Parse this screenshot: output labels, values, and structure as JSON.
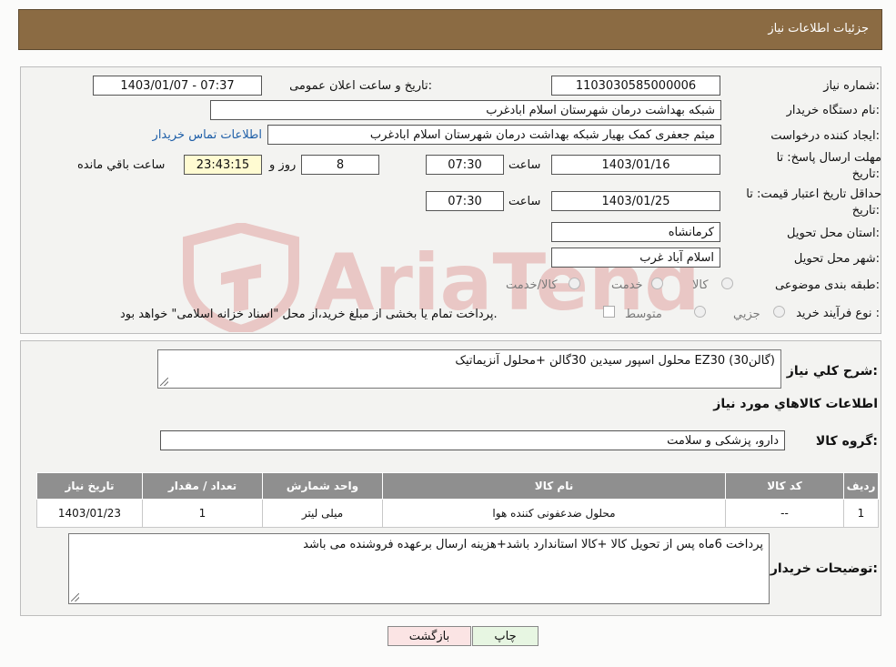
{
  "header": {
    "title": "جزئیات اطلاعات نیاز"
  },
  "form": {
    "need_number_label": "شماره نیاز:",
    "need_number": "1103030585000006",
    "announce_label": "تاریخ و ساعت اعلان عمومی:",
    "announce_value": "1403/01/07 - 07:37",
    "buyer_org_label": "نام دستگاه خریدار:",
    "buyer_org": "شبکه بهداشت درمان شهرستان اسلام ابادغرب",
    "creator_label": "ایجاد کننده درخواست:",
    "creator": "میثم جعفری کمک بهیار شبکه بهداشت درمان شهرستان اسلام ابادغرب",
    "contact_link": "اطلاعات تماس خریدار",
    "deadline_label_1": "مهلت ارسال پاسخ: تا",
    "deadline_label_2": "تاریخ:",
    "deadline_date": "1403/01/16",
    "time_label": "ساعت",
    "deadline_time": "07:30",
    "days_value": "8",
    "days_label": "روز و",
    "remaining_time": "23:43:15",
    "remaining_label": "ساعت باقي مانده",
    "validity_label_1": "حداقل تاریخ اعتبار قیمت: تا",
    "validity_label_2": "تاریخ:",
    "validity_date": "1403/01/25",
    "validity_time": "07:30",
    "province_label": "استان محل تحویل:",
    "province": "کرمانشاه",
    "city_label": "شهر محل تحویل:",
    "city": "اسلام آباد غرب",
    "category_label": "طبقه بندی موضوعی:",
    "category_options": [
      "کالا",
      "خدمت",
      "کالا/خدمت"
    ],
    "purchase_label": "نوع فرآیند خرید :",
    "purchase_options": [
      "جزیي",
      "متوسط"
    ],
    "purchase_note": "پرداخت تمام یا بخشی از مبلغ خرید،از محل \"اسناد خزانه اسلامی\" خواهد بود."
  },
  "details": {
    "summary_label": "شرح کلي نياز:",
    "summary": "محلول اسپور سیدین 30گالن +محلول آنزیماتیک EZ30 (30گالن)",
    "goods_info_title": "اطلاعات کالاهاي مورد نياز",
    "goods_group_label": "گروه کالا:",
    "goods_group": "دارو، پزشکی و سلامت",
    "table": {
      "headers": [
        "رديف",
        "کد کالا",
        "نام کالا",
        "واحد شمارش",
        "تعداد / مقدار",
        "تاریخ نیاز"
      ],
      "rows": [
        [
          "1",
          "--",
          "محلول ضدعفونی کننده هوا",
          "میلی لیتر",
          "1",
          "1403/01/23"
        ]
      ]
    },
    "buyer_notes_label": "توضيحات خريدار:",
    "buyer_notes": "پرداخت 6ماه پس از تحویل کالا +کالا استاندارد باشد+هزینه ارسال برعهده فروشنده می باشد"
  },
  "buttons": {
    "print": "چاپ",
    "back": "بازگشت"
  },
  "watermark": "AriaTender.neT",
  "colors": {
    "header_bg": "#8b6b43",
    "table_header_bg": "#8f8f8f",
    "remaining_bg": "#fffbd2",
    "link": "#1f5fa8"
  }
}
